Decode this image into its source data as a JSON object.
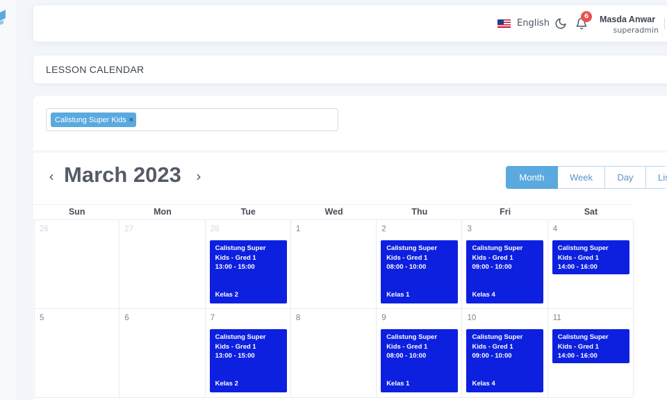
{
  "header": {
    "language": "English",
    "notification_count": "6",
    "user_name": "Masda Anwar",
    "user_role": "superadmin"
  },
  "page": {
    "title": "LESSON CALENDAR"
  },
  "filter": {
    "chip_label": "Calistung Super Kids",
    "chip_remove": "×"
  },
  "calendar": {
    "prev": "‹",
    "next": "›",
    "month_title": "March 2023",
    "views": [
      "Month",
      "Week",
      "Day",
      "Lis"
    ],
    "active_view": "Month",
    "weekdays": [
      "Sun",
      "Mon",
      "Tue",
      "Wed",
      "Thu",
      "Fri",
      "Sat"
    ],
    "weeks": [
      {
        "days": [
          {
            "num": "26",
            "other": true
          },
          {
            "num": "27",
            "other": true
          },
          {
            "num": "28",
            "other": true,
            "event": {
              "title": "Calistung Super Kids - Gred 1",
              "time": "13:00 - 15:00",
              "room": "Kelas 2"
            }
          },
          {
            "num": "1"
          },
          {
            "num": "2",
            "event": {
              "title": "Calistung Super Kids - Gred 1",
              "time": "08:00 - 10:00",
              "room": "Kelas 1"
            }
          },
          {
            "num": "3",
            "event": {
              "title": "Calistung Super Kids - Gred 1",
              "time": "09:00 - 10:00",
              "room": "Kelas 4"
            }
          },
          {
            "num": "4",
            "event": {
              "title": "Calistung Super Kids - Gred 1",
              "time": "14:00 - 16:00",
              "room": ""
            }
          }
        ]
      },
      {
        "days": [
          {
            "num": "5"
          },
          {
            "num": "6"
          },
          {
            "num": "7",
            "event": {
              "title": "Calistung Super Kids - Gred 1",
              "time": "13:00 - 15:00",
              "room": "Kelas 2"
            }
          },
          {
            "num": "8"
          },
          {
            "num": "9",
            "event": {
              "title": "Calistung Super Kids - Gred 1",
              "time": "08:00 - 10:00",
              "room": "Kelas 1"
            }
          },
          {
            "num": "10",
            "event": {
              "title": "Calistung Super Kids - Gred 1",
              "time": "09:00 - 10:00",
              "room": "Kelas 4"
            }
          },
          {
            "num": "11",
            "event": {
              "title": "Calistung Super Kids - Gred 1",
              "time": "14:00 - 16:00",
              "room": ""
            }
          }
        ]
      }
    ]
  },
  "colors": {
    "accent": "#5aa9df",
    "event_bg": "#0d20e0",
    "badge": "#e55353"
  },
  "icons": [
    "app-logo-icon",
    "us-flag-icon",
    "moon-icon",
    "bell-icon"
  ]
}
